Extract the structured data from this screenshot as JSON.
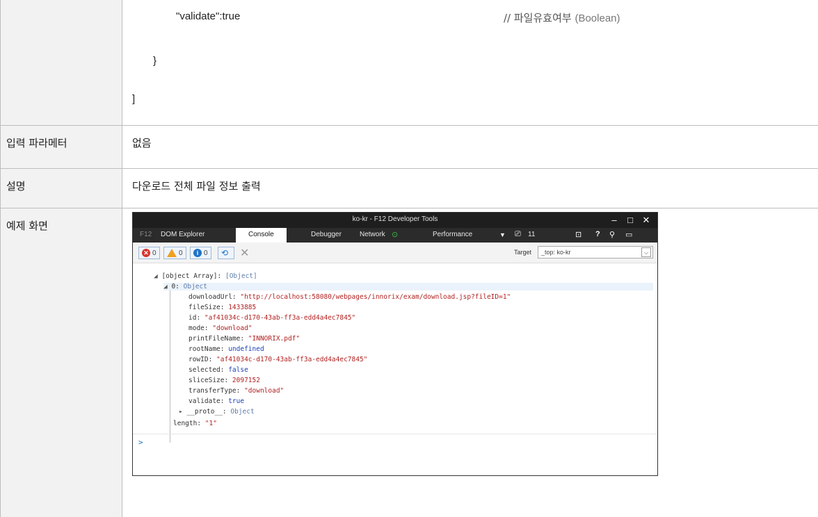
{
  "code_block": {
    "line_validate": "\"validate\":true",
    "comment_prefix": "// 파일유효여부",
    "comment_type": "(Boolean)",
    "brace_close": "}",
    "bracket_close": "]"
  },
  "rows": [
    {
      "label": "입력 파라메터",
      "value": "없음"
    },
    {
      "label": "설명",
      "value": "다운로드 전체 파일 정보 출력"
    },
    {
      "label": "예제 화면",
      "value": ""
    }
  ],
  "devtools": {
    "title": "ko-kr - F12 Developer Tools",
    "window_controls": {
      "minimize": "–",
      "maximize": "□",
      "close": "✕"
    },
    "tabs": {
      "f12": "F12",
      "dom_explorer": "DOM Explorer",
      "console": "Console",
      "debugger": "Debugger",
      "network": "Network",
      "performance": "Performance"
    },
    "emulation_count": "11",
    "toolbar": {
      "errors": "0",
      "warnings": "0",
      "info": "0",
      "target_label": "Target",
      "target_value": "_top: ko-kr"
    },
    "console_lines": {
      "root": "[object Array]: ",
      "root_val": "[Object]",
      "item0_key": "0: ",
      "item0_val": "Object",
      "download_key": "downloadUrl: ",
      "download_val": "\"http://localhost:58080/webpages/innorix/exam/download.jsp?fileID=1\"",
      "filesize_key": "fileSize: ",
      "filesize_val": "1433885",
      "id_key": "id: ",
      "id_val": "\"af41034c-d170-43ab-ff3a-edd4a4ec7845\"",
      "mode_key": "mode: ",
      "mode_val": "\"download\"",
      "printname_key": "printFileName: ",
      "printname_val": "\"INNORIX.pdf\"",
      "rootname_key": "rootName: ",
      "rootname_val": "undefined",
      "rowid_key": "rowID: ",
      "rowid_val": "\"af41034c-d170-43ab-ff3a-edd4a4ec7845\"",
      "selected_key": "selected: ",
      "selected_val": "false",
      "slicesize_key": "sliceSize: ",
      "slicesize_val": "2097152",
      "transfer_key": "transferType: ",
      "transfer_val": "\"download\"",
      "validate_key": "validate: ",
      "validate_val": "true",
      "proto_key": "__proto__: ",
      "proto_val": "Object",
      "length_key": "length: ",
      "length_val": "\"1\""
    },
    "prompt": ">"
  }
}
